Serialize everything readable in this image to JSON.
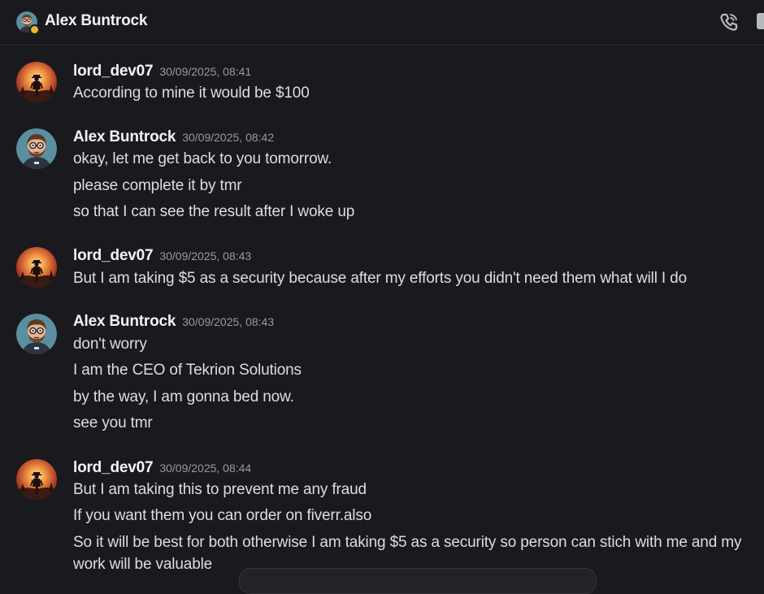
{
  "header": {
    "title": "Alex Buntrock",
    "status_color": "#f0b232"
  },
  "icons": {
    "call": "phone-call-icon",
    "video": "video-icon"
  },
  "messages": [
    {
      "user": "lord_dev07",
      "time": "30/09/2025, 08:41",
      "avatar": "lord",
      "lines": [
        "According to mine it would be $100"
      ]
    },
    {
      "user": "Alex Buntrock",
      "time": "30/09/2025, 08:42",
      "avatar": "alex",
      "lines": [
        "okay, let me get back to you tomorrow.",
        "please complete it by tmr",
        "so that I can see the result after I woke up"
      ]
    },
    {
      "user": "lord_dev07",
      "time": "30/09/2025, 08:43",
      "avatar": "lord",
      "lines": [
        "But I am taking $5 as a security because after my efforts you didn't need them what will I do"
      ]
    },
    {
      "user": "Alex Buntrock",
      "time": "30/09/2025, 08:43",
      "avatar": "alex",
      "lines": [
        "don't worry",
        "I am the CEO of Tekrion Solutions",
        "by the way, I am gonna bed now.",
        "see you tmr"
      ]
    },
    {
      "user": "lord_dev07",
      "time": "30/09/2025, 08:44",
      "avatar": "lord",
      "lines": [
        "But I am taking this to prevent me any fraud",
        "If you want them you can order on fiverr.also",
        "So it will be best for both otherwise I am taking $5 as a security so person can stich with me and my work will be valuable"
      ]
    }
  ]
}
